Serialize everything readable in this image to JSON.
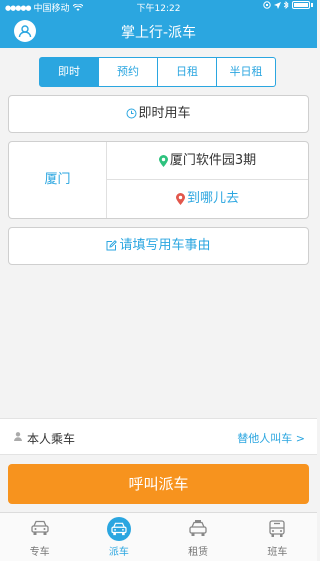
{
  "status_bar": {
    "carrier": "中国移动",
    "time": "下午12:22"
  },
  "nav": {
    "title": "掌上行-派车",
    "avatar_icon": "user-avatar-icon"
  },
  "segments": [
    {
      "label": "即时",
      "active": true
    },
    {
      "label": "预约",
      "active": false
    },
    {
      "label": "日租",
      "active": false
    },
    {
      "label": "半日租",
      "active": false
    }
  ],
  "time_card": {
    "label": "即时用车",
    "icon": "clock-icon"
  },
  "route": {
    "city": "厦门",
    "from": "厦门软件园3期",
    "to": "到哪儿去"
  },
  "reason": {
    "label": "请填写用车事由",
    "icon": "edit-icon"
  },
  "passenger": {
    "label": "本人乘车",
    "other_label": "替他人叫车 >"
  },
  "call_button": {
    "label": "呼叫派车"
  },
  "tabs": [
    {
      "label": "专车",
      "icon": "car-icon",
      "active": false
    },
    {
      "label": "派车",
      "icon": "car-icon",
      "active": true
    },
    {
      "label": "租赁",
      "icon": "taxi-icon",
      "active": false
    },
    {
      "label": "班车",
      "icon": "bus-icon",
      "active": false
    }
  ],
  "colors": {
    "primary": "#2ba6e0",
    "accent": "#f7931e",
    "from_pin": "#2ec27e",
    "to_pin": "#e2574c"
  }
}
